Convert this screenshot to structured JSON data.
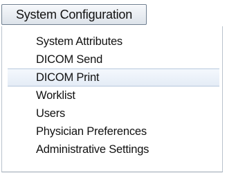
{
  "menu": {
    "title": "System Configuration",
    "items": [
      {
        "label": "System Attributes"
      },
      {
        "label": "DICOM Send"
      },
      {
        "label": "DICOM Print"
      },
      {
        "label": "Worklist"
      },
      {
        "label": "Users"
      },
      {
        "label": "Physician Preferences"
      },
      {
        "label": "Administrative Settings"
      }
    ],
    "highlighted_item": "DICOM Print"
  },
  "colors": {
    "header_border": "#6f7f90",
    "highlight_border": "#b6c8dc",
    "highlight_fill": "#e4ecf6"
  }
}
